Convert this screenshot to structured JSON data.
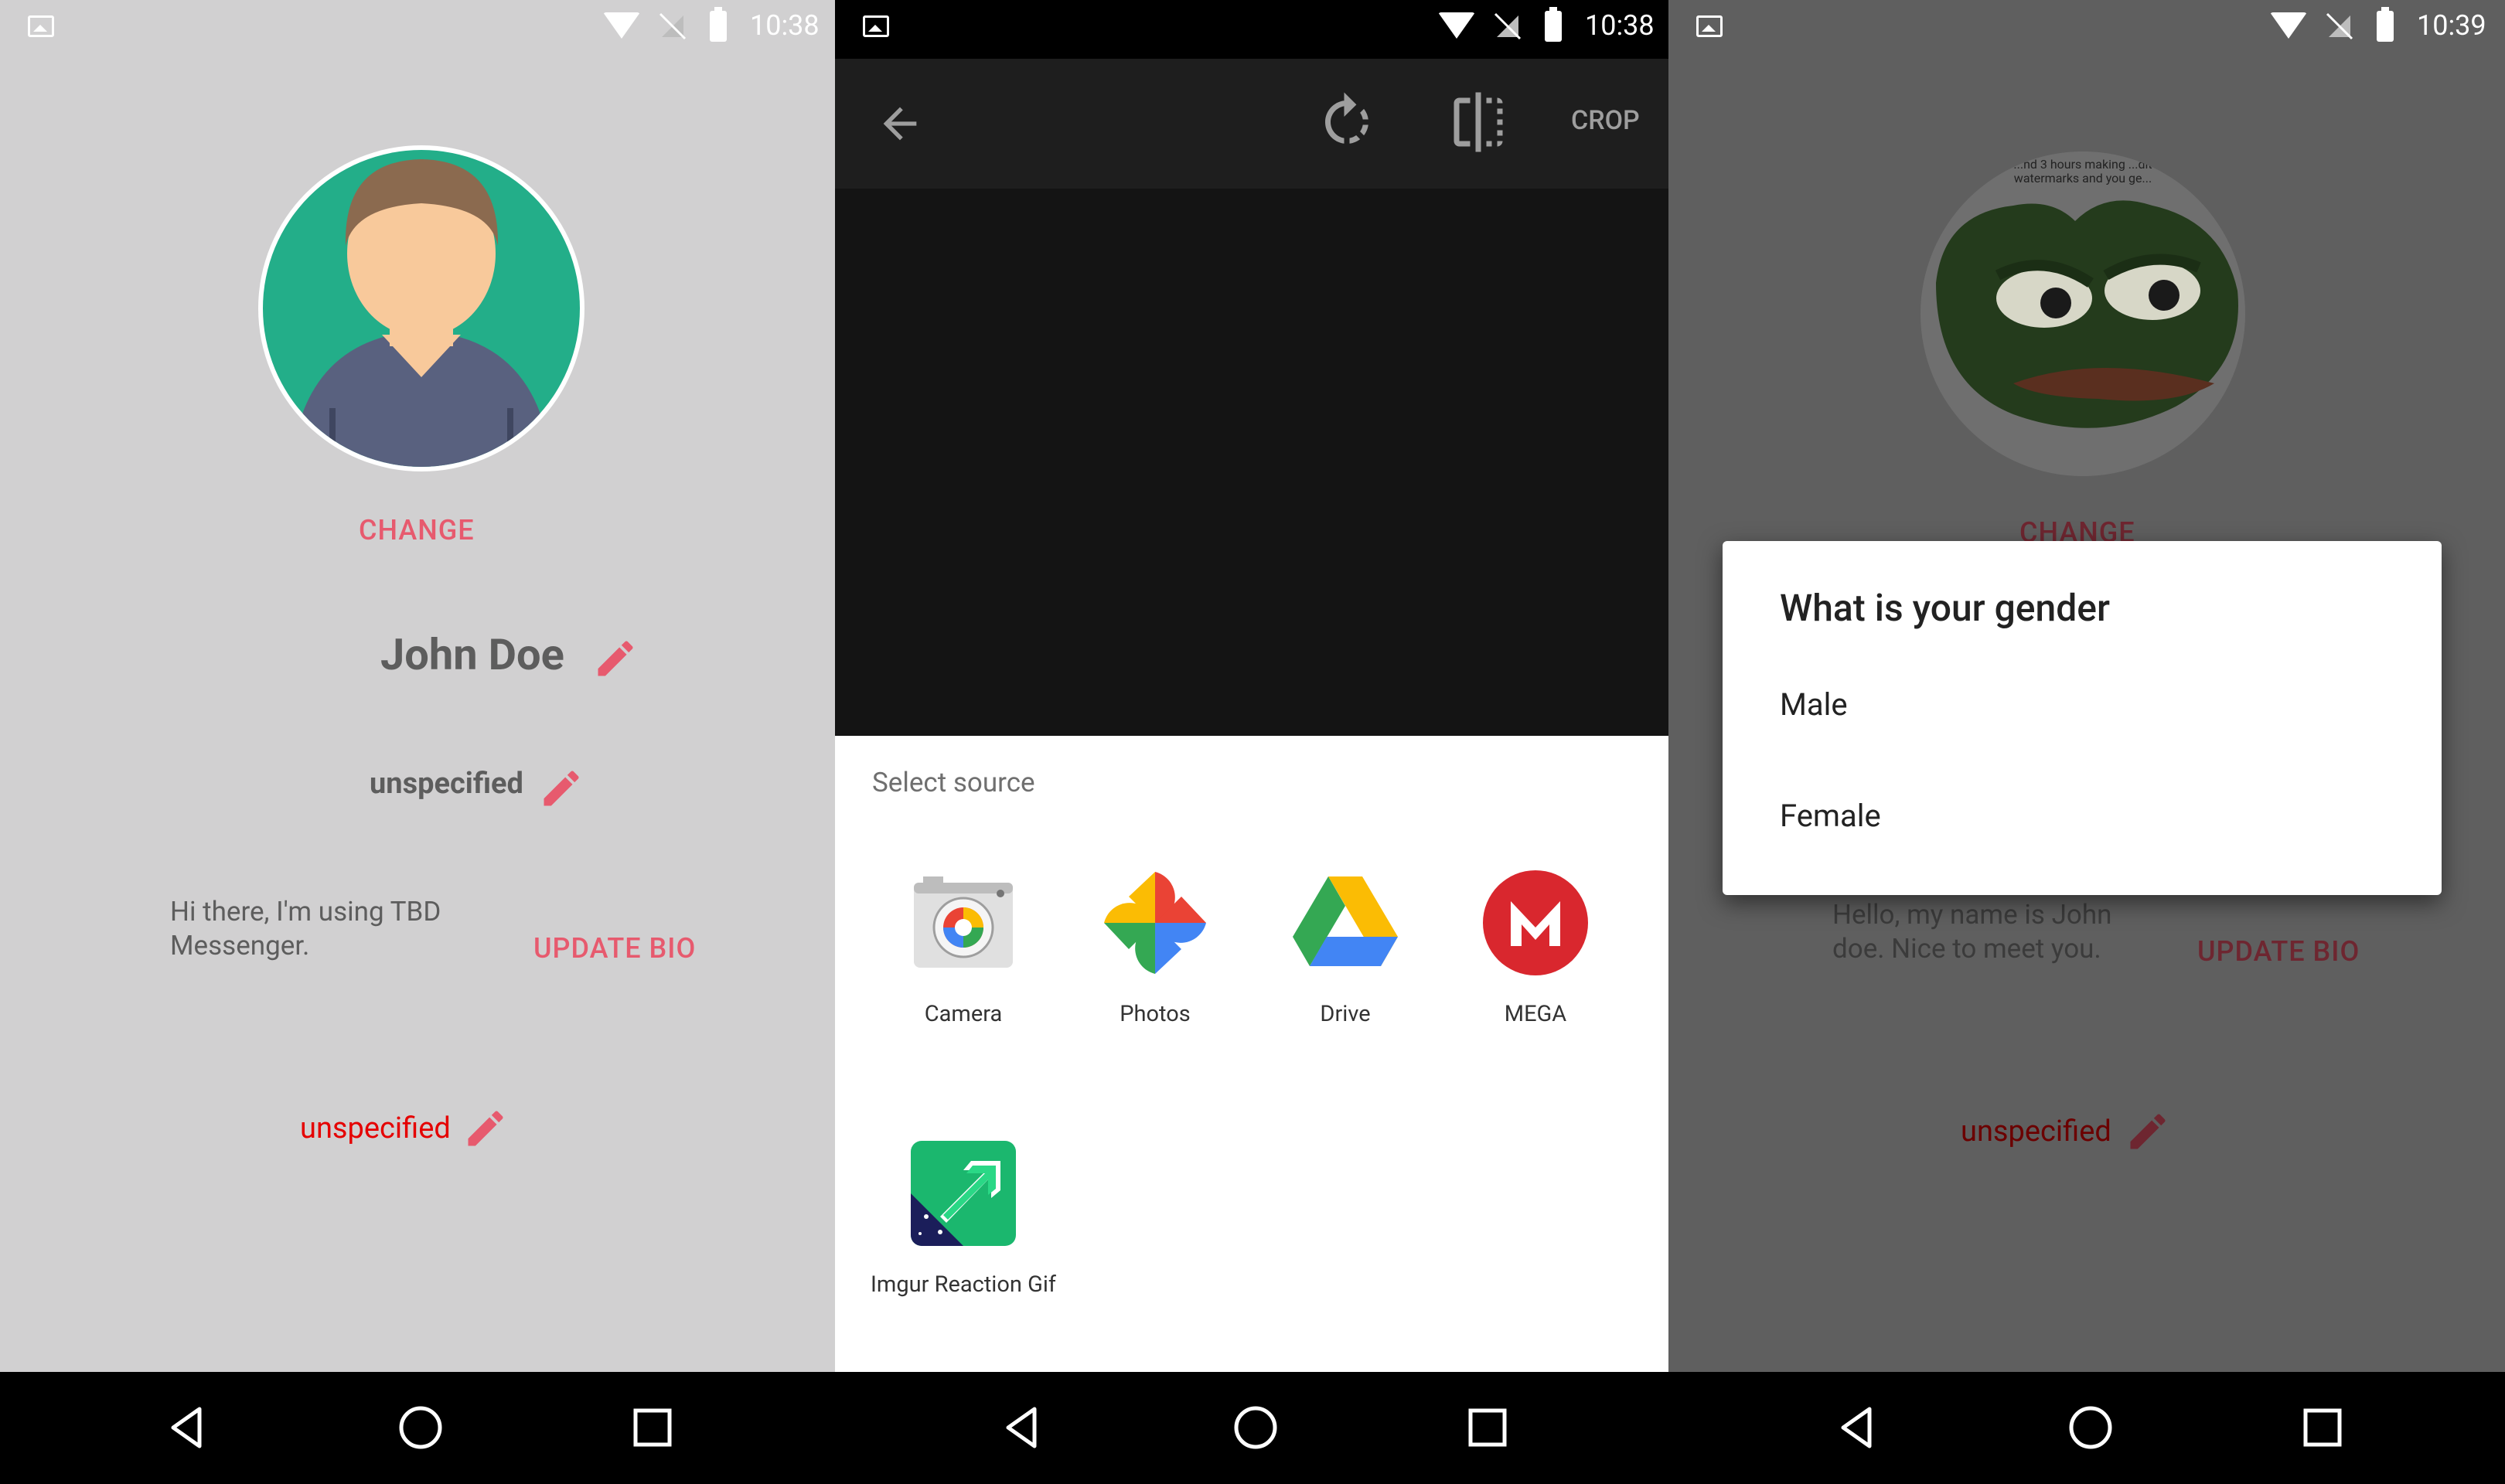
{
  "screen1": {
    "status_time": "10:38",
    "change_label": "CHANGE",
    "name": "John Doe",
    "gender": "unspecified",
    "bio": "Hi there, I'm using TBD Messenger.",
    "update_bio_label": "UPDATE BIO",
    "field": "unspecified"
  },
  "screen2": {
    "status_time": "10:38",
    "crop_label": "CROP",
    "sheet_title": "Select source",
    "apps": [
      {
        "label": "Camera",
        "icon": "camera-icon"
      },
      {
        "label": "Photos",
        "icon": "photos-icon"
      },
      {
        "label": "Drive",
        "icon": "drive-icon"
      },
      {
        "label": "MEGA",
        "icon": "mega-icon"
      },
      {
        "label": "Imgur Reaction Gif",
        "icon": "imgur-icon"
      }
    ]
  },
  "screen3": {
    "status_time": "10:39",
    "change_label": "CHANGE",
    "bio": "Hello, my name is John doe. Nice to meet you.",
    "update_bio_label": "UPDATE BIO",
    "field": "unspecified",
    "avatar_caption": "...nd 3 hours making ...dit watermarks and you ge...",
    "dialog": {
      "title": "What is your gender",
      "options": [
        "Male",
        "Female"
      ]
    }
  },
  "colors": {
    "accent": "#e75a6e",
    "red": "#e50000",
    "avatar_green": "#23ae89"
  }
}
